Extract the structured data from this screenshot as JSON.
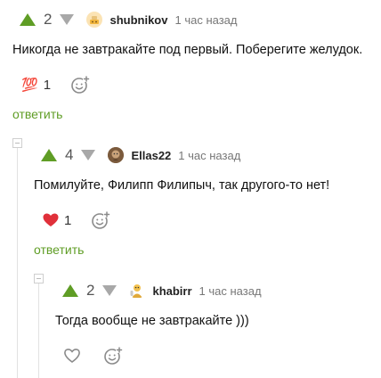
{
  "comments": [
    {
      "score": "2",
      "username": "shubnikov",
      "time": "1 час назад",
      "text": "Никогда не завтракайте под первый. Поберегите желудок.",
      "reaction_emoji": "💯",
      "reaction_count": "1",
      "reply_label": "ответить"
    },
    {
      "score": "4",
      "username": "Ellas22",
      "time": "1 час назад",
      "text": "Помилуйте, Филипп Филипыч, так другого-то нет!",
      "reaction_emoji": "❤",
      "reaction_count": "1",
      "reply_label": "ответить"
    },
    {
      "score": "2",
      "username": "khabirr",
      "time": "1 час назад",
      "text": "Тогда вообще не завтракайте )))"
    }
  ],
  "icons": {
    "upvote": "triangle-up-green",
    "downvote": "triangle-down-gray",
    "add_reaction": "smiley-plus-icon",
    "like": "heart-outline-icon"
  },
  "colors": {
    "accent": "#5f9d25",
    "muted": "#a8a8a8",
    "heart": "#e0303a"
  }
}
